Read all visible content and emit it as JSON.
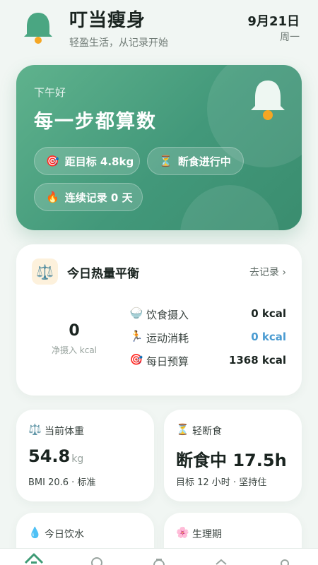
{
  "header": {
    "app_name": "叮当瘦身",
    "slogan": "轻盈生活，从记录开始",
    "date": "9月21日",
    "weekday": "周一"
  },
  "hero": {
    "greeting": "下午好",
    "headline": "每一步都算数",
    "chips": {
      "target": {
        "icon": "🎯",
        "label": "距目标 4.8kg"
      },
      "fasting": {
        "icon": "⏳",
        "label": "断食进行中"
      },
      "streak": {
        "icon": "🔥",
        "label": "连续记录 0 天"
      }
    }
  },
  "calorie_card": {
    "icon": "⚖️",
    "title": "今日热量平衡",
    "link": "去记录 ›",
    "net_value": "0",
    "net_label": "净摄入 kcal",
    "rows": [
      {
        "icon": "🍚",
        "label": "饮食摄入",
        "value": "0 kcal"
      },
      {
        "icon": "🏃",
        "label": "运动消耗",
        "value": "0 kcal"
      },
      {
        "icon": "🎯",
        "label": "每日预算",
        "value": "1368 kcal"
      }
    ]
  },
  "weight_card": {
    "icon": "⚖️",
    "title": "当前体重",
    "value": "54.8",
    "unit": "kg",
    "sub": "BMI 20.6 · 标准"
  },
  "fasting_card": {
    "icon": "⏳",
    "title": "轻断食",
    "value": "断食中 17.5h",
    "sub": "目标 12 小时 · 坚持住"
  },
  "water_card": {
    "icon": "💧",
    "title": "今日饮水"
  },
  "period_card": {
    "icon": "🌸",
    "title": "生理期"
  },
  "nav": {
    "items": [
      "home-icon",
      "food-icon",
      "timer-icon",
      "stats-icon",
      "profile-icon"
    ],
    "active_color": "#3f9b76"
  },
  "colors": {
    "brand": "#4aa682",
    "bell_dot": "#f5a623",
    "burn_value": "#4a9bd1"
  }
}
